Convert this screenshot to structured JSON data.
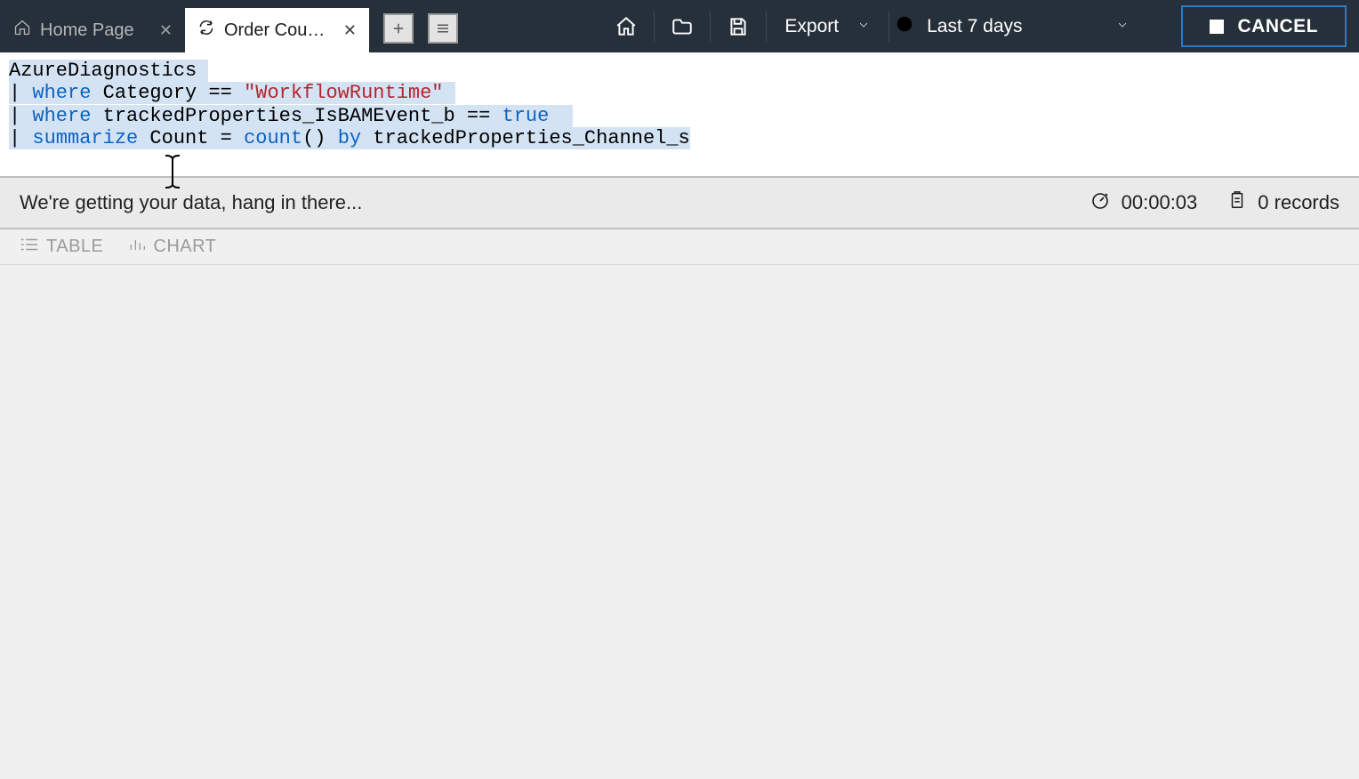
{
  "tabs": [
    {
      "label": "Home Page"
    },
    {
      "label": "Order Count ..."
    }
  ],
  "toolbar": {
    "export_label": "Export",
    "time_label": "Last 7 days",
    "cancel_label": "CANCEL"
  },
  "query": {
    "line1_table": "AzureDiagnostics",
    "line2_pipe": "| ",
    "line2_where": "where",
    "line2_rest1": " Category == ",
    "line2_string": "\"WorkflowRuntime\"",
    "line3_pipe": "| ",
    "line3_where": "where",
    "line3_rest": " trackedProperties_IsBAMEvent_b == ",
    "line3_true": "true",
    "line4_pipe": "| ",
    "line4_summarize": "summarize",
    "line4_rest1": " Count = ",
    "line4_count": "count",
    "line4_rest2": "() ",
    "line4_by": "by",
    "line4_rest3": " trackedProperties_Channel_s"
  },
  "status": {
    "message": "We're getting your data, hang in there...",
    "timer": "00:00:03",
    "records": "0 records"
  },
  "views": {
    "table": "TABLE",
    "chart": "CHART"
  }
}
